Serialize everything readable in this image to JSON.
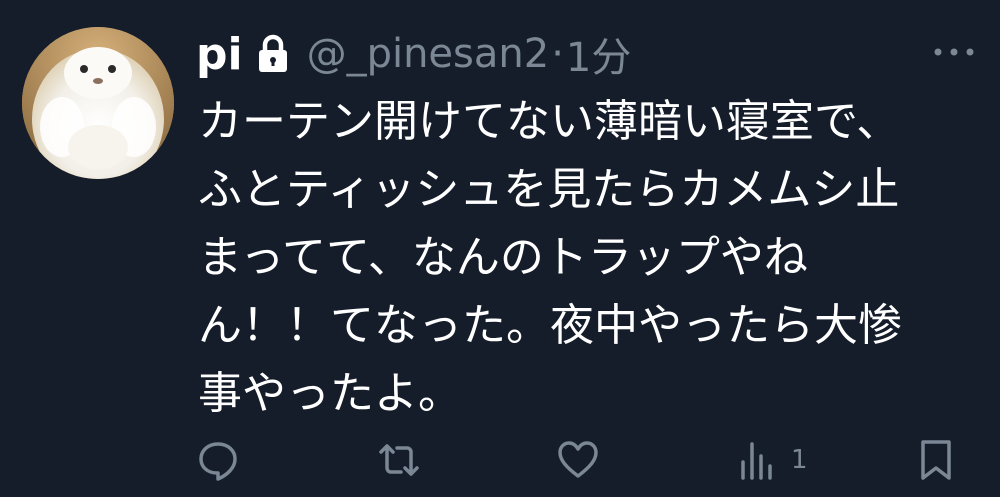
{
  "user": {
    "display_name": "pi",
    "handle": "@_pinesan2",
    "separator": "·",
    "time": "1分"
  },
  "tweet": {
    "lines": [
      "カーテン開けてない薄暗い寝室で、",
      "ふとティッシュを見たらカメムシ止",
      "まってて、なんのトラップやね",
      "ん！！てなった。夜中やったら大惨",
      "事やったよ。"
    ]
  },
  "actions": {
    "views_count": "1"
  },
  "icons": {
    "lock": "lock-icon",
    "more": "more-icon",
    "reply": "reply-icon",
    "retweet": "retweet-icon",
    "like": "like-icon",
    "views": "views-icon",
    "bookmark": "bookmark-icon"
  },
  "colors": {
    "background": "#151d2a",
    "text": "#ffffff",
    "muted": "#7b8794"
  }
}
